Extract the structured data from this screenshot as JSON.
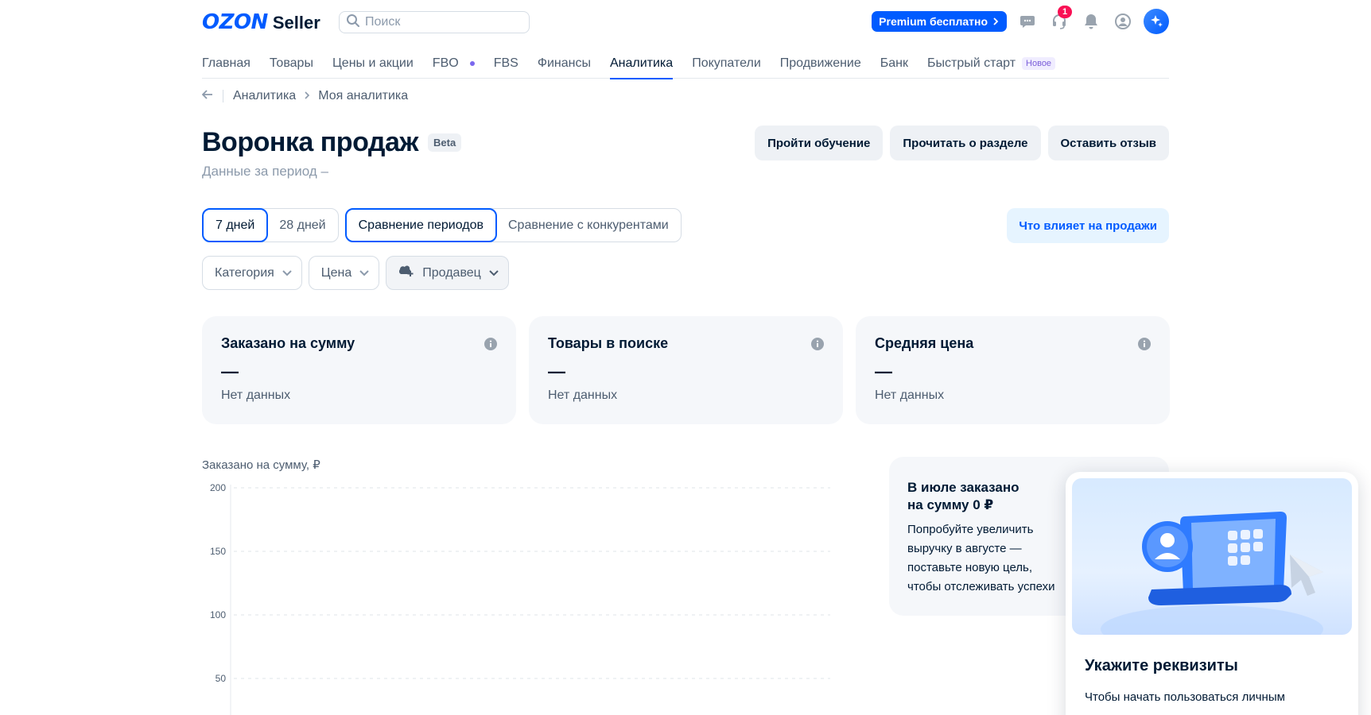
{
  "header": {
    "logo_brand": "OZON",
    "logo_product": "Seller",
    "search_placeholder": "Поиск",
    "premium_label": "Premium бесплатно",
    "notifications_count": "1"
  },
  "nav": {
    "items": [
      {
        "label": "Главная"
      },
      {
        "label": "Товары"
      },
      {
        "label": "Цены и акции"
      },
      {
        "label": "FBO"
      },
      {
        "label": "FBS"
      },
      {
        "label": "Финансы"
      },
      {
        "label": "Аналитика"
      },
      {
        "label": "Покупатели"
      },
      {
        "label": "Продвижение"
      },
      {
        "label": "Банк"
      },
      {
        "label": "Быстрый старт"
      }
    ],
    "new_badge": "Новое",
    "active_index": 6
  },
  "breadcrumb": {
    "items": [
      "Аналитика",
      "Моя аналитика"
    ]
  },
  "page": {
    "title": "Воронка продаж",
    "beta": "Beta",
    "subtitle": "Данные за период –",
    "actions": [
      "Пройти обучение",
      "Прочитать о разделе",
      "Оставить отзыв"
    ]
  },
  "period": {
    "options": [
      "7 дней",
      "28 дней"
    ],
    "selected": "7 дней"
  },
  "compare": {
    "options": [
      "Сравнение периодов",
      "Сравнение с конкурентами"
    ],
    "selected": "Сравнение периодов"
  },
  "influence_button": "Что влияет на продажи",
  "filters": [
    "Категория",
    "Цена",
    "Продавец"
  ],
  "cards": [
    {
      "title": "Заказано на сумму",
      "value": "—",
      "sub": "Нет данных"
    },
    {
      "title": "Товары в поиске",
      "value": "—",
      "sub": "Нет данных"
    },
    {
      "title": "Средняя цена",
      "value": "—",
      "sub": "Нет данных"
    }
  ],
  "chart_data": {
    "type": "line",
    "title": "",
    "ylabel": "Заказано на сумму, ₽",
    "xlabel": "",
    "ylim": [
      0,
      200
    ],
    "yticks": [
      "200",
      "150",
      "100",
      "50"
    ],
    "series": [],
    "grid": true
  },
  "promo": {
    "title": "В июле заказано на сумму 0 ₽",
    "text": "Попробуйте увеличить выручку в августе — поставьте новую цель, чтобы отслеживать успехи"
  },
  "popup": {
    "title": "Укажите реквизиты",
    "text": "Чтобы начать пользоваться личным"
  },
  "colors": {
    "brand": "#005bff",
    "text": "#001a34",
    "muted": "#4d5d70",
    "card_bg": "#f5f7fa",
    "badge": "#f91155"
  }
}
